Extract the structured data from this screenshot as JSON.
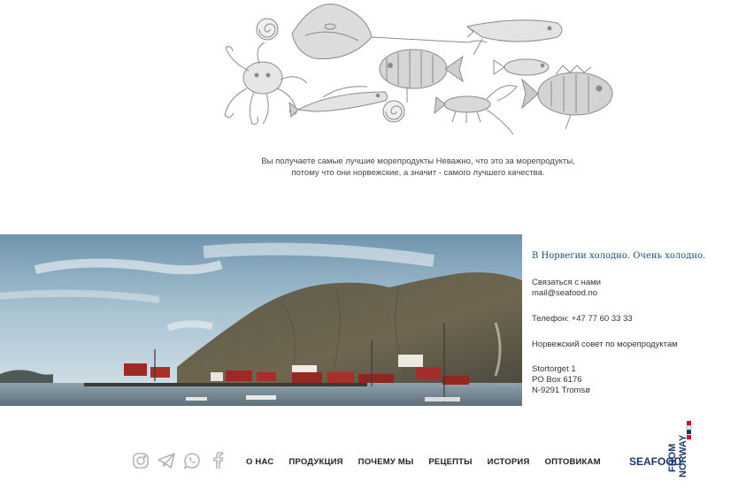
{
  "tagline": "Вы получаете самые лучшие морепродукты Неважно, что это за морепродукты, потому что они норвежские, а значит - самого лучшего качества.",
  "contacts": {
    "headline": "В Норвегии холодно. Очень холодно.",
    "contact_label": "Связаться с нами",
    "email": "mail@seafood.no",
    "phone": "Телефон: +47 77 60 33 33",
    "org": "Норвежский совет по морепродуктам",
    "address_1": "Stortorget 1",
    "address_2": "PO Box 6176",
    "address_3": "N-9291 Tromsø"
  },
  "social": {
    "icons": [
      "instagram-icon",
      "telegram-icon",
      "whatsapp-icon",
      "facebook-icon"
    ]
  },
  "nav": {
    "items": [
      "О НАС",
      "ПРОДУКЦИЯ",
      "ПОЧЕМУ МЫ",
      "РЕЦЕПТЫ",
      "ИСТОРИЯ",
      "ОПТОВИКАМ"
    ]
  },
  "logo": {
    "word_1": "SEAFOOD",
    "word_2": "FROM",
    "word_3": "NORWAY"
  },
  "colors": {
    "headline": "#1d4e73",
    "logo_navy": "#1b3a6b",
    "logo_red": "#c8102e",
    "icon_gray": "#b5b5b5"
  }
}
